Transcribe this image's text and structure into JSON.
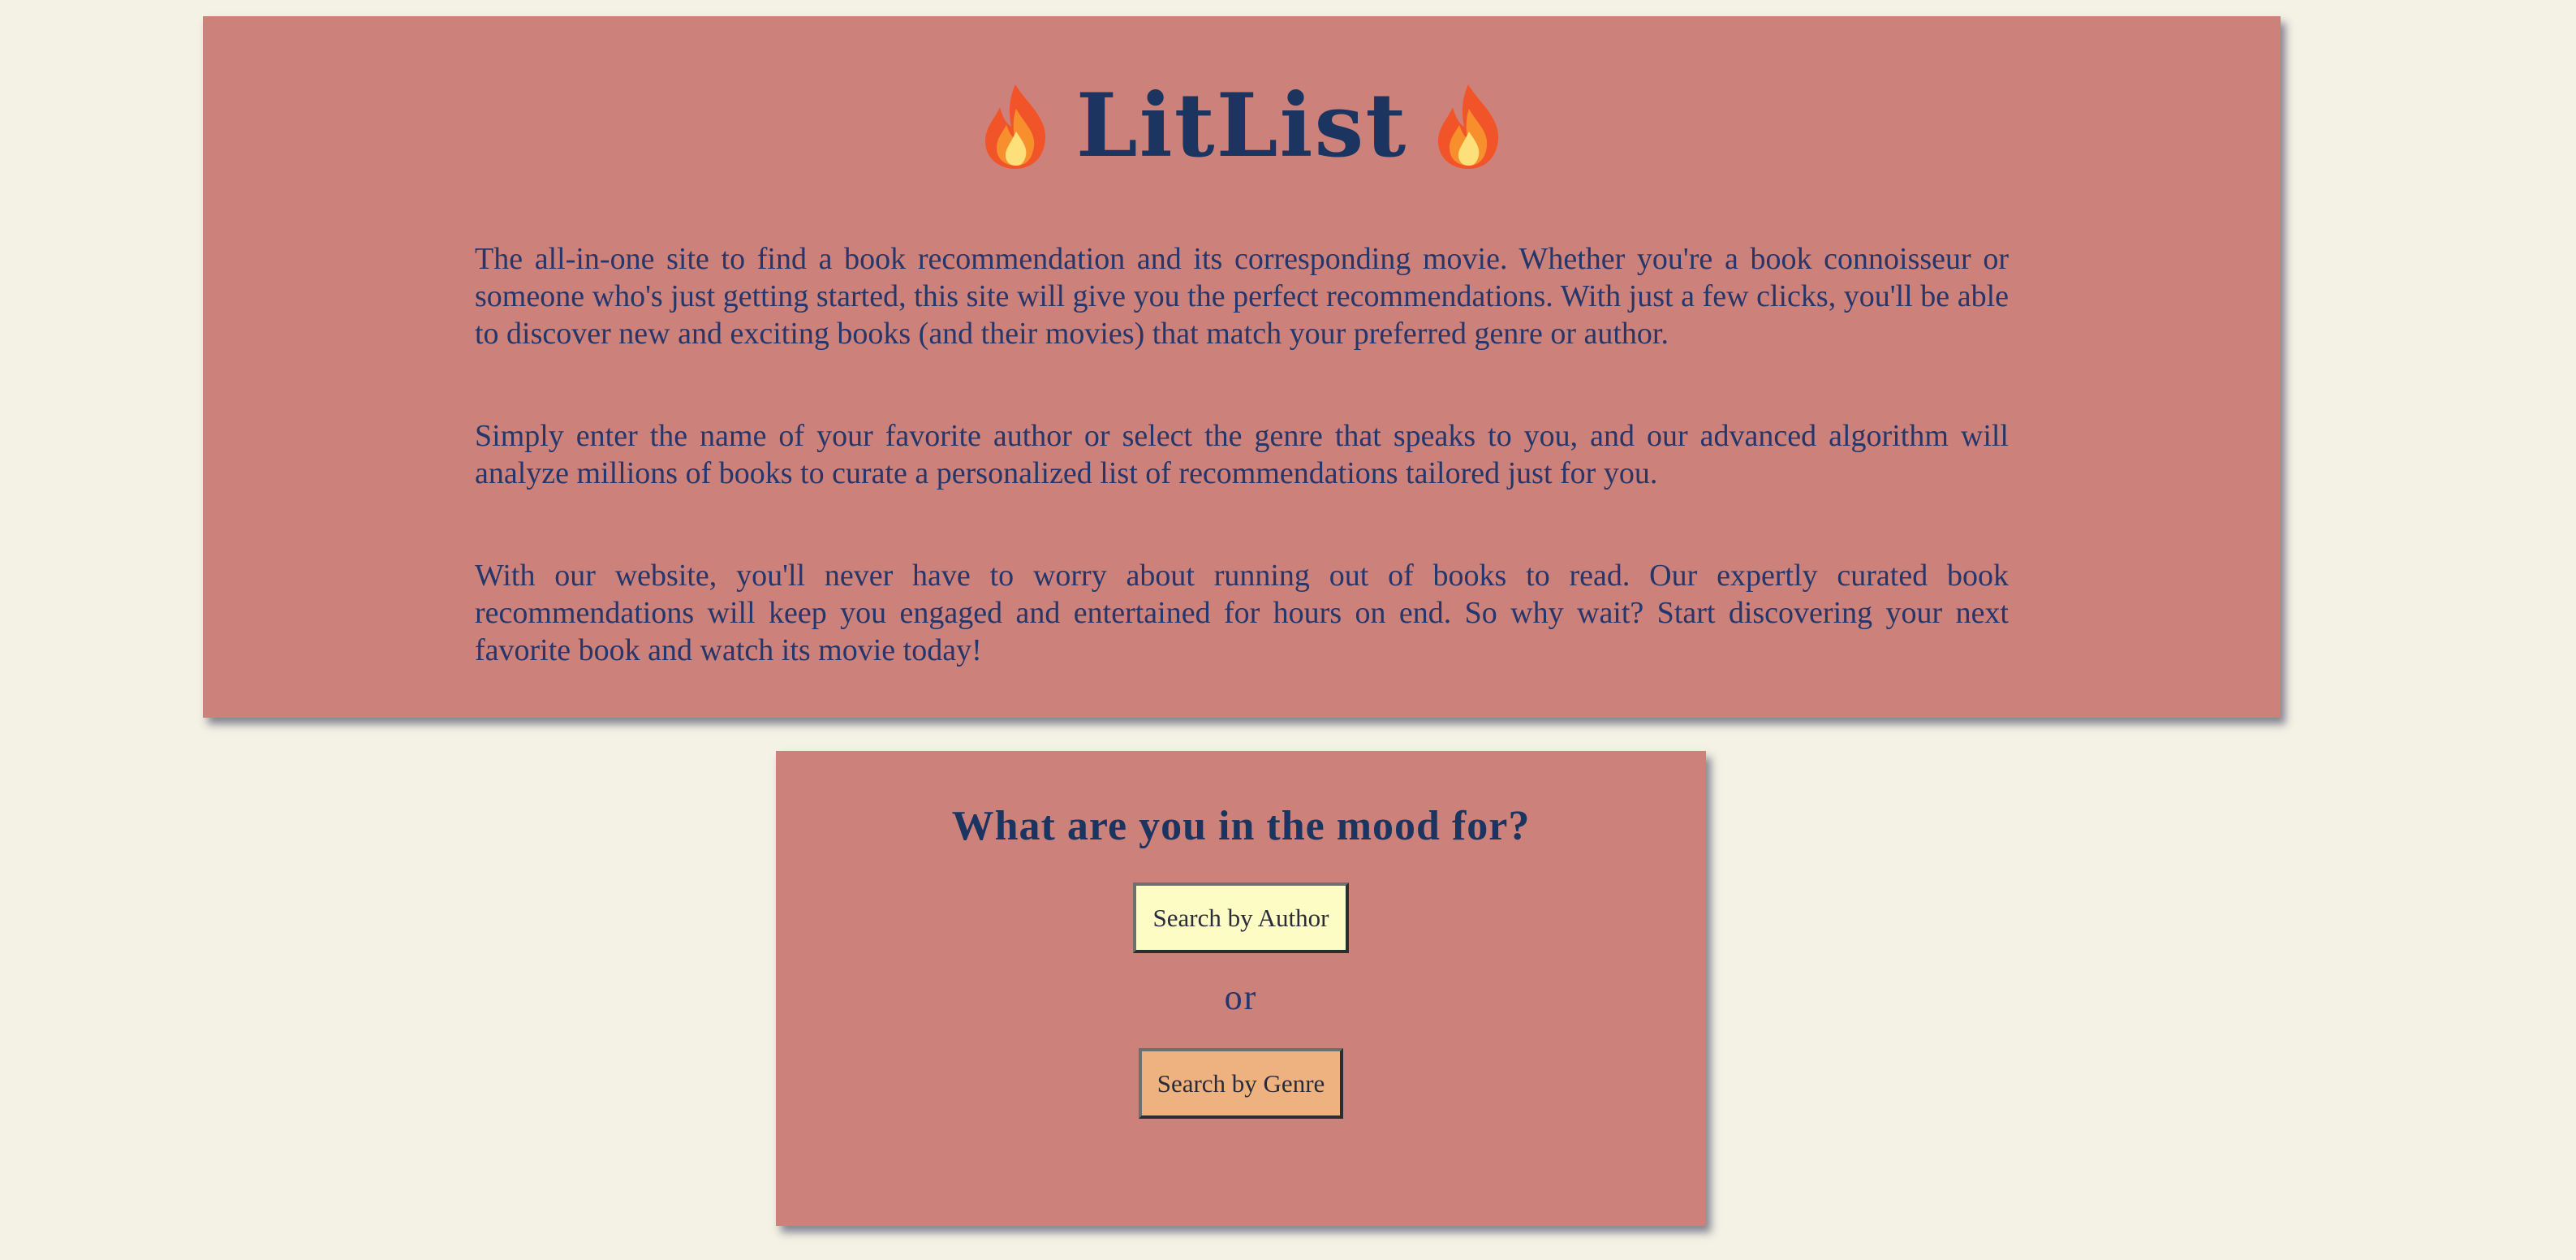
{
  "hero": {
    "title": "LitList",
    "title_icon": "fire-emoji",
    "paragraphs": [
      "The all-in-one site to find a book recommendation and its corresponding movie. Whether you're a book connoisseur or someone who's just getting started, this site will give you the perfect recommendations. With just a few clicks, you'll be able to discover new and exciting books (and their movies) that match your preferred genre or author.",
      "Simply enter the name of your favorite author or select the genre that speaks to you, and our advanced algorithm will analyze millions of books to curate a personalized list of recommendations tailored just for you.",
      "With our website, you'll never have to worry about running out of books to read. Our expertly curated book recommendations will keep you engaged and entertained for hours on end. So why wait? Start discovering your next favorite book and watch its movie today!"
    ]
  },
  "mood": {
    "title": "What are you in the mood for?",
    "author_button_label": "Search by Author",
    "or_text": "or",
    "genre_button_label": "Search by Genre"
  },
  "colors": {
    "background": "#f4f2e4",
    "card": "#cc827b",
    "heading": "#1b3460",
    "author_button": "#fcfcc4",
    "genre_button": "#eeb280"
  }
}
